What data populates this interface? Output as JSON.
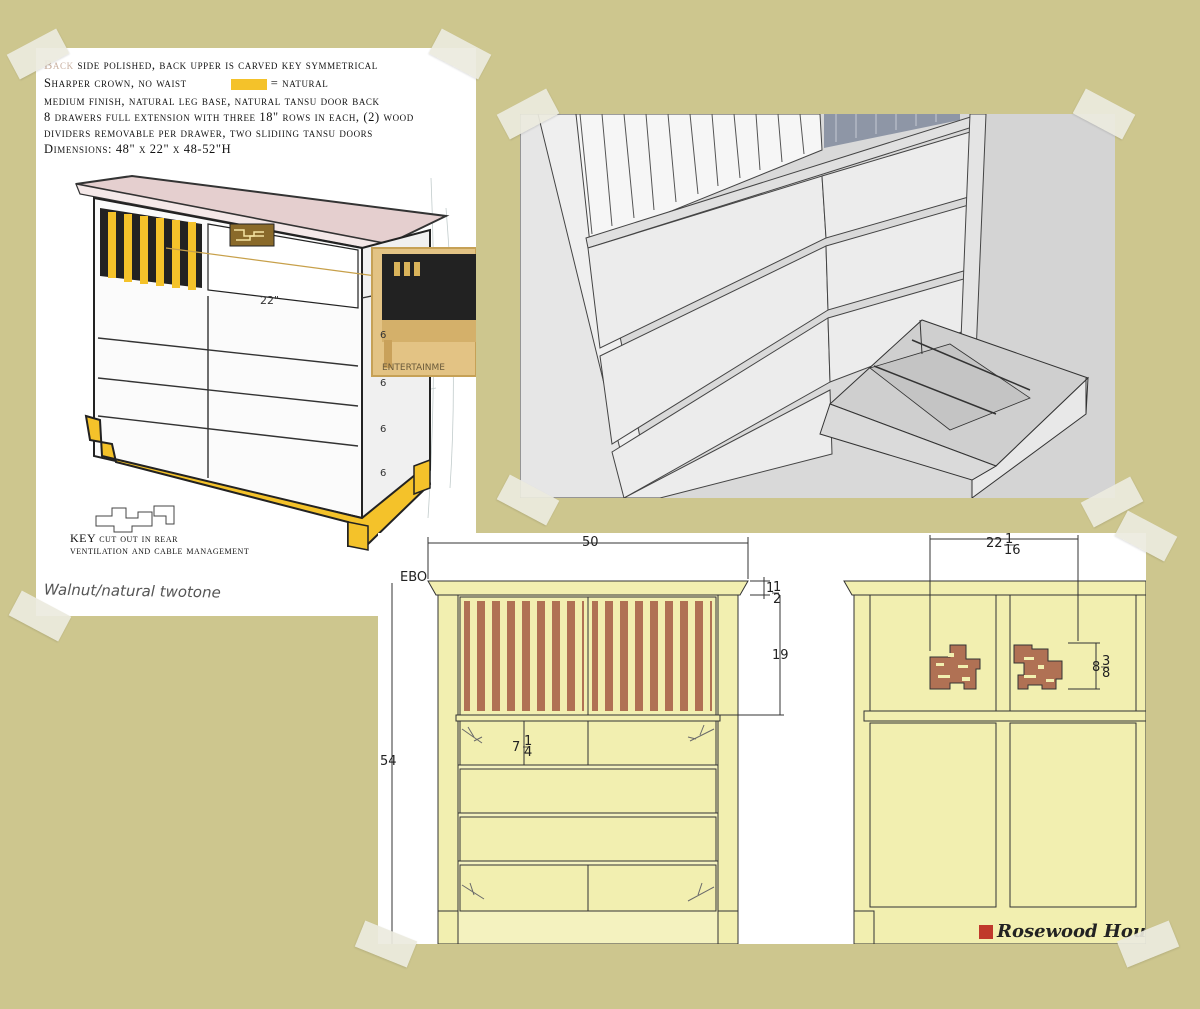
{
  "sketch": {
    "notes": {
      "line1_faded": "Back",
      "line1": " side polished, back upper is carved key symmetrical",
      "line2": "Sharper crown, no waist",
      "swatch_label": "= natural",
      "line3": "medium finish, natural leg base, natural tansu door back",
      "line4": "8 drawers full extension with three 18\" rows in each, (2) wood",
      "line5": "dividers removable per drawer, two slidiing tansu doors",
      "line6": "Dimensions: 48\" x 22\" x 48-52\"H"
    },
    "key_label_1": "KEY cut out in rear",
    "key_label_2": "ventilation and cable management",
    "handwriting": "Walnut/natural twotone",
    "inset_label": "ENTERTAINME",
    "dim_22": "22\"",
    "drawer_marks": [
      "6",
      "6",
      "6",
      "6"
    ]
  },
  "elevation": {
    "ebo_label": "EBO",
    "front": {
      "width_label": "50",
      "height_label": "54",
      "crown_whole": "1",
      "crown_num": "1",
      "crown_den": "2",
      "upper_label": "19",
      "drawer_whole": "7",
      "drawer_num": "1",
      "drawer_den": "4"
    },
    "back": {
      "key_span_whole": "22",
      "key_span_num": "1",
      "key_span_den": "16",
      "key_height_whole": "8",
      "key_height_num": "3",
      "key_height_den": "8"
    },
    "brand": "Rosewood Hou"
  },
  "colors": {
    "board": "#cdc68e",
    "natural": "#f4c22a",
    "cabinet_yellow": "#f2efb0",
    "rosewood": "#b07154",
    "render_gray": "#d9d9d9"
  }
}
